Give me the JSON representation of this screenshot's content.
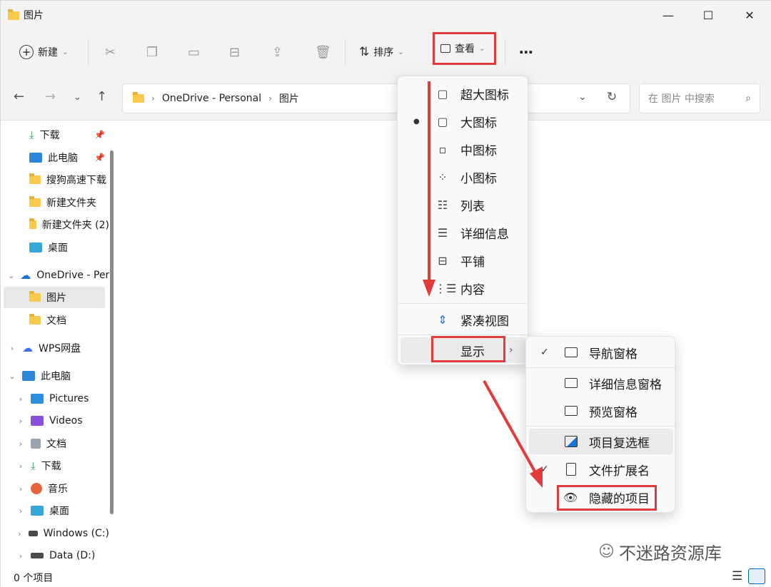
{
  "window": {
    "title": "图片",
    "controls": {
      "minimize": "—",
      "maximize": "☐",
      "close": "✕"
    }
  },
  "toolbar": {
    "new_label": "新建",
    "sort_label": "排序",
    "view_label": "查看",
    "more_label": "⋯"
  },
  "address": {
    "breadcrumb": [
      "OneDrive - Personal",
      "图片"
    ],
    "search_placeholder": "在 图片 中搜索"
  },
  "sidebar": {
    "items": [
      {
        "label": "下载",
        "icon": "download-icon"
      },
      {
        "label": "此电脑",
        "icon": "computer-icon"
      },
      {
        "label": "搜狗高速下载",
        "icon": "folder-icon"
      },
      {
        "label": "新建文件夹",
        "icon": "folder-icon"
      },
      {
        "label": "新建文件夹 (2)",
        "icon": "folder-icon"
      },
      {
        "label": "桌面",
        "icon": "desktop-icon"
      },
      {
        "label": "OneDrive - Personal",
        "icon": "cloud-icon"
      },
      {
        "label": "图片",
        "icon": "folder-icon"
      },
      {
        "label": "文档",
        "icon": "folder-icon"
      },
      {
        "label": "WPS网盘",
        "icon": "cloud-icon"
      },
      {
        "label": "此电脑",
        "icon": "computer-icon"
      },
      {
        "label": "Pictures",
        "icon": "pictures-icon"
      },
      {
        "label": "Videos",
        "icon": "videos-icon"
      },
      {
        "label": "文档",
        "icon": "document-icon"
      },
      {
        "label": "下载",
        "icon": "download-icon"
      },
      {
        "label": "音乐",
        "icon": "music-icon"
      },
      {
        "label": "桌面",
        "icon": "desktop-icon"
      },
      {
        "label": "Windows (C:)",
        "icon": "drive-icon"
      },
      {
        "label": "Data (D:)",
        "icon": "drive-icon"
      }
    ]
  },
  "view_menu": {
    "items": [
      {
        "label": "超大图标",
        "icon": "extra-large-icons-icon"
      },
      {
        "label": "大图标",
        "icon": "large-icons-icon",
        "selected": true
      },
      {
        "label": "中图标",
        "icon": "medium-icons-icon"
      },
      {
        "label": "小图标",
        "icon": "small-icons-icon"
      },
      {
        "label": "列表",
        "icon": "list-icon"
      },
      {
        "label": "详细信息",
        "icon": "details-icon"
      },
      {
        "label": "平铺",
        "icon": "tiles-icon"
      },
      {
        "label": "内容",
        "icon": "content-icon"
      }
    ],
    "compact_label": "紧凑视图",
    "show_label": "显示"
  },
  "show_menu": {
    "items": [
      {
        "label": "导航窗格",
        "checked": true,
        "icon": "navigation-pane-icon"
      },
      {
        "label": "详细信息窗格",
        "checked": false,
        "icon": "details-pane-icon"
      },
      {
        "label": "预览窗格",
        "checked": false,
        "icon": "preview-pane-icon"
      },
      {
        "label": "项目复选框",
        "checked": false,
        "icon": "item-checkbox-icon"
      },
      {
        "label": "文件扩展名",
        "checked": true,
        "icon": "file-extension-icon"
      },
      {
        "label": "隐藏的项目",
        "checked": false,
        "icon": "eye-icon"
      }
    ]
  },
  "status": {
    "count_text": "0 个项目"
  },
  "watermark": {
    "text": "不迷路资源库"
  },
  "colors": {
    "highlight": "#e23b3b",
    "folder": "#f8c94a",
    "accent": "#0067c0"
  }
}
